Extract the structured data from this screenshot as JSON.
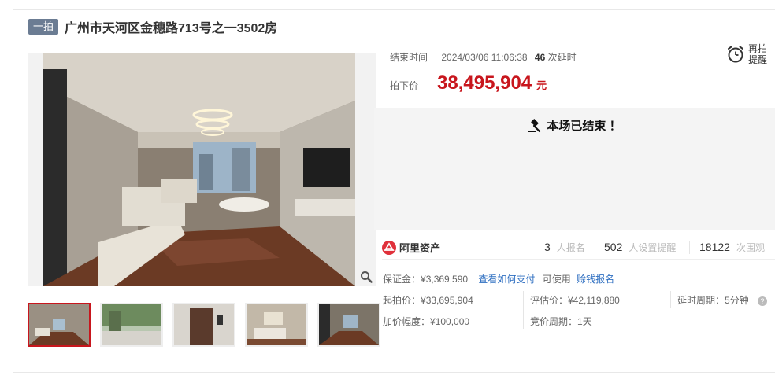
{
  "listing": {
    "badge": "一拍",
    "title": "广州市天河区金穗路713号之一3502房"
  },
  "auction": {
    "end_label": "结束时间",
    "end_time": "2024/03/06 11:06:38",
    "delay_count": "46",
    "delay_label": "次延时",
    "price_label": "拍下价",
    "price": "38,495,904",
    "price_unit": "元",
    "remind_label": "再拍提醒",
    "ended_text": "本场已结束 ！"
  },
  "stats": {
    "platform": "阿里资产",
    "signup_count": "3",
    "signup_label": "人报名",
    "reminder_count": "502",
    "reminder_label": "人设置提醒",
    "view_count": "18122",
    "view_label": "次围观"
  },
  "terms": {
    "deposit_label": "保证金：",
    "deposit": "¥3,369,590",
    "deposit_link": "查看如何支付",
    "usable_label": "可使用",
    "signup_link": "赊钱报名",
    "start_price_label": "起拍价：",
    "start_price": "¥33,695,904",
    "assess_price_label": "评估价：",
    "assess_price": "¥42,119,880",
    "delay_period_label": "延时周期：",
    "delay_period": "5分钟",
    "increment_label": "加价幅度：",
    "increment": "¥100,000",
    "bid_period_label": "竞价周期：",
    "bid_period": "1天"
  },
  "colors": {
    "accent_red": "#c8161d",
    "link_blue": "#2f6fc1",
    "badge_gray": "#6b7c93"
  },
  "icons": {
    "remind": "alarm-clock-icon",
    "zoom": "magnifier-icon",
    "ended": "gavel-icon",
    "platform": "ali-asset-logo-icon",
    "help": "question-icon"
  }
}
